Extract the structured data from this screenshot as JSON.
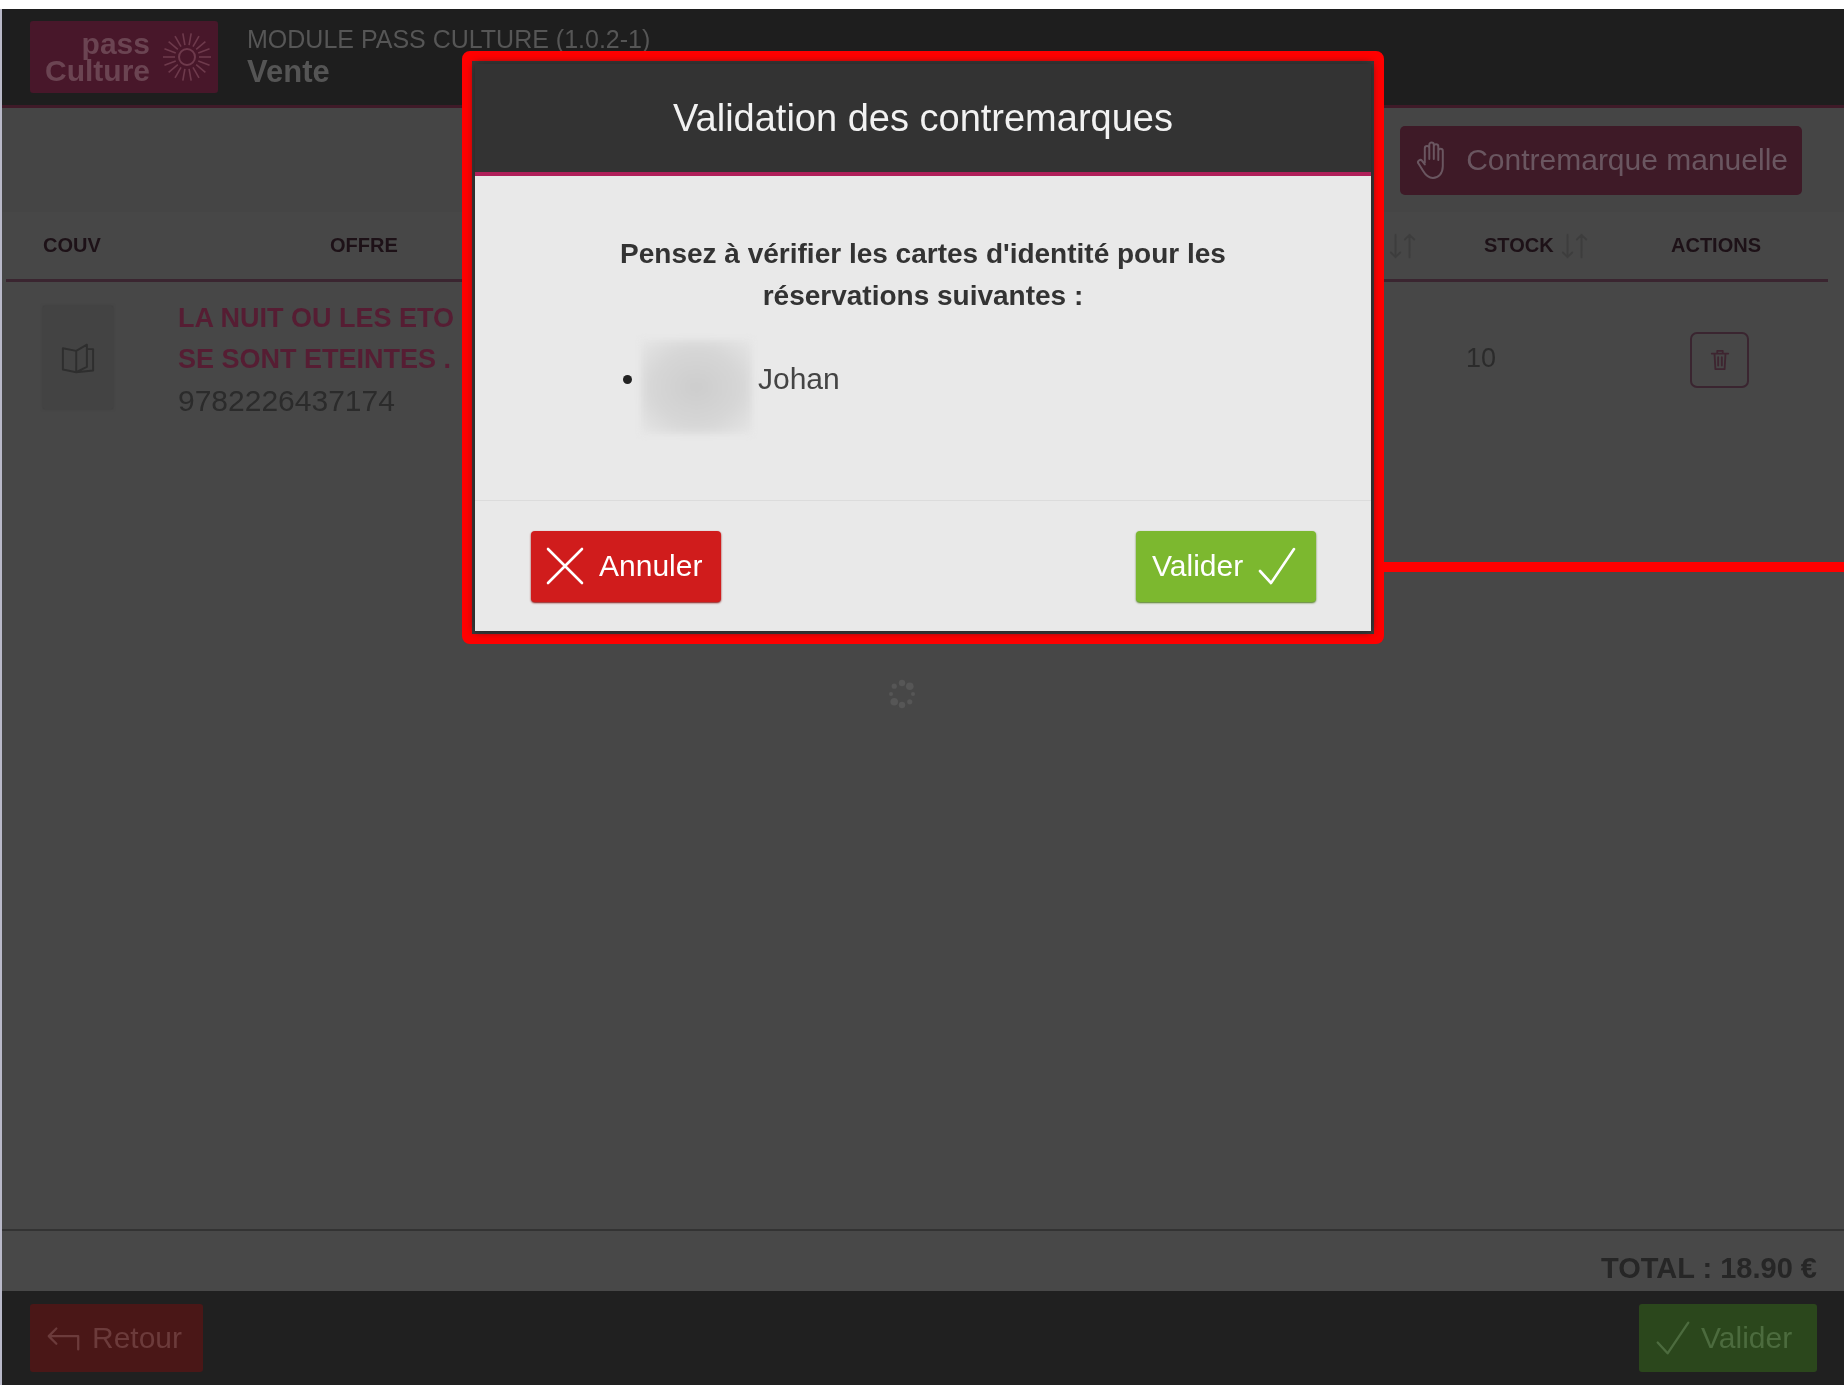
{
  "header": {
    "logo": [
      "pass",
      "Culture"
    ],
    "module": "MODULE PASS CULTURE (1.0.2-1)",
    "title": "Vente"
  },
  "toolbar": {
    "button": "Contremarque manuelle"
  },
  "table": {
    "columns": [
      {
        "label": "COUV",
        "sortable": false
      },
      {
        "label": "OFFRE",
        "sortable": false
      },
      {
        "sortable": true
      },
      {
        "label": "STOCK",
        "sortable": true
      },
      {
        "label": "ACTIONS",
        "sortable": false
      }
    ],
    "rows": [
      {
        "title_lines": [
          "LA NUIT OU LES ETO",
          "SE SONT ETEINTES ."
        ],
        "isbn": "9782226437174",
        "stock": "10"
      }
    ]
  },
  "total": "TOTAL : 18.90 €",
  "footer": {
    "buttons": [
      {
        "kind": "back",
        "label": "Retour"
      },
      {
        "kind": "confirm",
        "label": "Valider"
      }
    ]
  },
  "dialog": {
    "title": "Validation des contremarques",
    "message": "Pensez à vérifier les cartes d'identité pour les réservations suivantes :",
    "reservations": [
      "Johan"
    ],
    "buttons": [
      {
        "kind": "cancel",
        "label": "Annuler"
      },
      {
        "kind": "confirm",
        "label": "Valider"
      }
    ]
  }
}
